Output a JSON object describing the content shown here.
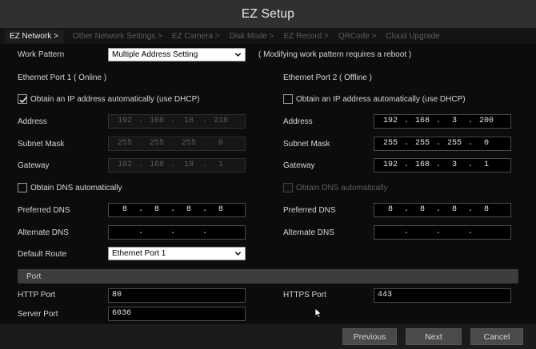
{
  "window": {
    "title": "EZ Setup"
  },
  "tabs": [
    {
      "label": "EZ Network >",
      "active": true
    },
    {
      "label": "Other Network Settings >",
      "active": false
    },
    {
      "label": "EZ Camera >",
      "active": false
    },
    {
      "label": "Disk Mode >",
      "active": false
    },
    {
      "label": "EZ Record >",
      "active": false
    },
    {
      "label": "QRCode >",
      "active": false
    },
    {
      "label": "Cloud Upgrade",
      "active": false
    }
  ],
  "work_pattern": {
    "label": "Work Pattern",
    "value": "Multiple Address Setting",
    "note": "( Modifying work pattern requires a reboot )"
  },
  "port1": {
    "heading": "Ethernet Port 1 ( Online )",
    "dhcp_label": "Obtain an IP address automatically (use DHCP)",
    "dhcp_checked": true,
    "address_label": "Address",
    "address": [
      "192",
      "168",
      "18",
      "218"
    ],
    "subnet_label": "Subnet Mask",
    "subnet": [
      "255",
      "255",
      "255",
      "0"
    ],
    "gateway_label": "Gateway",
    "gateway": [
      "192",
      "168",
      "18",
      "1"
    ],
    "dns_auto_label": "Obtain DNS automatically",
    "dns_auto_checked": false,
    "pref_dns_label": "Preferred DNS",
    "pref_dns": [
      "8",
      "8",
      "8",
      "8"
    ],
    "alt_dns_label": "Alternate DNS",
    "alt_dns": [
      "",
      "",
      "",
      ""
    ],
    "default_route_label": "Default Route",
    "default_route": "Ethernet Port 1"
  },
  "port2": {
    "heading": "Ethernet Port 2 ( Offline )",
    "dhcp_label": "Obtain an IP address automatically (use DHCP)",
    "dhcp_checked": false,
    "address_label": "Address",
    "address": [
      "192",
      "168",
      "3",
      "200"
    ],
    "subnet_label": "Subnet Mask",
    "subnet": [
      "255",
      "255",
      "255",
      "0"
    ],
    "gateway_label": "Gateway",
    "gateway": [
      "192",
      "168",
      "3",
      "1"
    ],
    "dns_auto_label": "Obtain DNS automatically",
    "dns_auto_checked": false,
    "pref_dns_label": "Preferred DNS",
    "pref_dns": [
      "8",
      "8",
      "8",
      "8"
    ],
    "alt_dns_label": "Alternate DNS",
    "alt_dns": [
      "",
      "",
      "",
      ""
    ]
  },
  "port_section": {
    "title": "Port",
    "http_label": "HTTP Port",
    "http_value": "80",
    "https_label": "HTTPS Port",
    "https_value": "443",
    "server_label": "Server Port",
    "server_value": "6036"
  },
  "footer": {
    "previous": "Previous",
    "next": "Next",
    "cancel": "Cancel"
  },
  "icons": {
    "checkmark": "checkmark-icon",
    "dropdown": "chevron-down-icon",
    "cursor": "mouse-pointer-icon"
  },
  "colors": {
    "background": "#0c0c0c",
    "titlebar": "#303030",
    "section_bar": "#3d3d3d",
    "button": "#4a4a4a"
  }
}
